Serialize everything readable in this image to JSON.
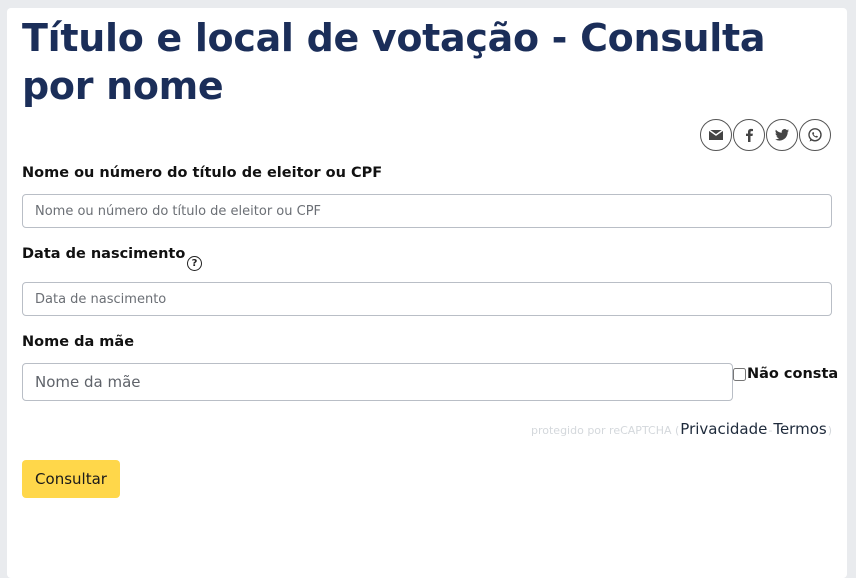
{
  "page": {
    "title": "Título e local de votação - Consulta por nome"
  },
  "share": {
    "icons": [
      "envelope-icon",
      "facebook-icon",
      "twitter-icon",
      "whatsapp-icon"
    ]
  },
  "form": {
    "titulo": {
      "label": "Nome ou número do título de eleitor ou CPF",
      "placeholder": "Nome ou número do título de eleitor ou CPF",
      "value": ""
    },
    "nascimento": {
      "label": "Data de nascimento",
      "help_glyph": "?",
      "placeholder": "Data de nascimento",
      "value": ""
    },
    "mae": {
      "label": "Nome da mãe",
      "placeholder": "Nome da mãe",
      "value": "",
      "nao_consta_label": "Não consta",
      "nao_consta_checked": false
    },
    "recaptcha": {
      "text": "protegido por reCAPTCHA (",
      "privacy": "Privacidade",
      "separator": " - ",
      "terms": "Termos",
      "close": ")"
    },
    "submit_label": "Consultar"
  },
  "colors": {
    "title": "#1b2e59",
    "submit_bg": "#ffd74a",
    "background": "#e9ebee"
  }
}
